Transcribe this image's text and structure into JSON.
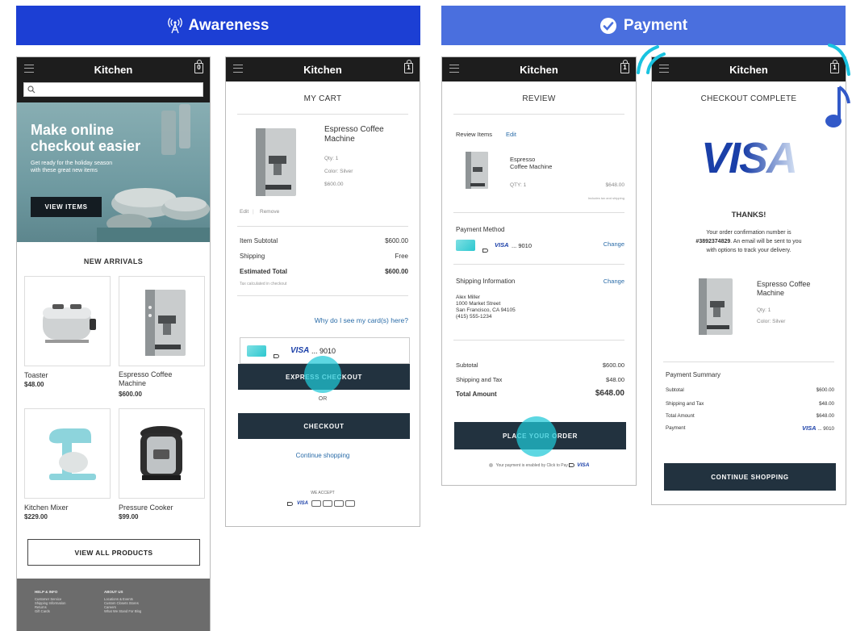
{
  "banners": {
    "awareness": "Awareness",
    "payment": "Payment"
  },
  "colors": {
    "awareness_banner": "#1c3fd4",
    "payment_banner": "#4a6fde",
    "header": "#1d1d1d",
    "button": "#22323f",
    "tap_highlight": "#1ec8d7",
    "link": "#2a6ca8",
    "visa_blue": "#1a3fa8"
  },
  "icons": {
    "awareness": "broadcast-icon",
    "payment": "checkmark-circle-icon",
    "menu": "menu-icon",
    "cart": "shopping-bag-icon",
    "search": "search-icon",
    "card": "credit-card-icon",
    "contactless": "contactless-icon",
    "music": "music-note-icon"
  },
  "store": "Kitchen",
  "home": {
    "cart_count": "0",
    "hero_title_1": "Make online",
    "hero_title_2": "checkout easier",
    "hero_sub_1": "Get ready for the holiday season",
    "hero_sub_2": "with these great new items",
    "hero_button": "VIEW ITEMS",
    "section_title": "NEW ARRIVALS",
    "products": [
      {
        "name": "Toaster",
        "price": "$48.00"
      },
      {
        "name": "Espresso Coffee Machine",
        "price": "$600.00"
      },
      {
        "name": "Kitchen Mixer",
        "price": "$229.00"
      },
      {
        "name": "Pressure Cooker",
        "price": "$99.00"
      }
    ],
    "view_all": "VIEW ALL PRODUCTS",
    "footer": {
      "col1_title": "HELP & INFO",
      "col1": [
        "Customer Service",
        "Shipping Information",
        "Returns",
        "Gift Cards"
      ],
      "col2_title": "ABOUT US",
      "col2": [
        "Locations & Events",
        "Custom Closets Stores",
        "Careers",
        "What We Stand For Blog"
      ]
    }
  },
  "cart": {
    "cart_count": "1",
    "title": "MY CART",
    "item_name_1": "Espresso Coffee",
    "item_name_2": "Machine",
    "qty": "Qty: 1",
    "color": "Color: Silver",
    "price": "$600.00",
    "edit": "Edit",
    "remove": "Remove",
    "subtotal_label": "Item Subtotal",
    "subtotal": "$600.00",
    "shipping_label": "Shipping",
    "shipping": "Free",
    "est_label": "Estimated Total",
    "est": "$600.00",
    "tax_note": "Tax calculated in checkout",
    "why": "Why do I see my card(s) here?",
    "card_brand": "VISA",
    "card_digits": "... 9010",
    "express": "EXPRESS CHECKOUT",
    "or": "OR",
    "checkout": "CHECKOUT",
    "continue": "Continue shopping",
    "we_accept": "WE ACCEPT",
    "accept_brand": "VISA"
  },
  "review": {
    "cart_count": "1",
    "title": "REVIEW",
    "items_label": "Review Items",
    "edit": "Edit",
    "item_1": "Espresso",
    "item_2": "Coffee Machine",
    "qty": "QTY: 1",
    "price": "$648.00",
    "tax_note": "Includes tax and shipping",
    "payment_label": "Payment Method",
    "card_brand": "VISA",
    "card_digits": "... 9010",
    "change": "Change",
    "shipping_label": "Shipping Information",
    "address": [
      "Alex Miller",
      "1000 Market Street",
      "San Francisco, CA 94105",
      "(415) 555-1234"
    ],
    "subtotal_label": "Subtotal",
    "subtotal": "$600.00",
    "ship_tax_label": "Shipping and Tax",
    "ship_tax": "$48.00",
    "total_label": "Total Amount",
    "total": "$648.00",
    "place": "PLACE YOUR ORDER",
    "enabled": "Your payment is enabled by Click to Pay",
    "enabled_brand": "VISA"
  },
  "complete": {
    "cart_count": "1",
    "title": "CHECKOUT COMPLETE",
    "logo": "VISA",
    "thanks": "THANKS!",
    "conf_1": "Your order confirmation number is",
    "conf_num": "#3892374829",
    "conf_2": ". An email will be sent to you",
    "conf_3": "with options to track your delivery.",
    "item_1": "Espresso Coffee",
    "item_2": "Machine",
    "qty": "Qty: 1",
    "color": "Color: Silver",
    "summary": "Payment Summary",
    "rows": [
      {
        "label": "Subtotal",
        "value": "$600.00"
      },
      {
        "label": "Shipping and Tax",
        "value": "$48.00"
      },
      {
        "label": "Total Amount",
        "value": "$648.00"
      }
    ],
    "payment_label": "Payment",
    "card_brand": "VISA",
    "card_digits": "... 9010",
    "continue": "CONTINUE SHOPPING"
  }
}
